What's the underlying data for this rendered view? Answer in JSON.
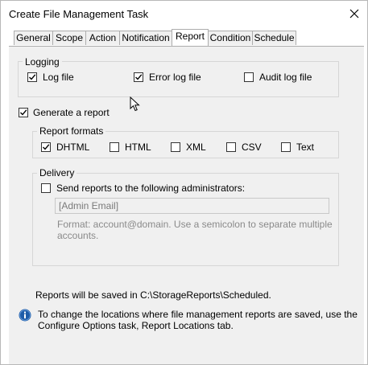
{
  "window": {
    "title": "Create File Management Task"
  },
  "tabs": [
    {
      "label": "General"
    },
    {
      "label": "Scope"
    },
    {
      "label": "Action"
    },
    {
      "label": "Notification"
    },
    {
      "label": "Report",
      "active": true
    },
    {
      "label": "Condition"
    },
    {
      "label": "Schedule"
    }
  ],
  "logging": {
    "group_label": "Logging",
    "log_file": {
      "label": "Log file",
      "checked": true
    },
    "error_log_file": {
      "label": "Error log file",
      "checked": true
    },
    "audit_log_file": {
      "label": "Audit log file",
      "checked": false
    }
  },
  "generate_report": {
    "label": "Generate a report",
    "checked": true
  },
  "report_formats": {
    "group_label": "Report formats",
    "dhtml": {
      "label": "DHTML",
      "checked": true
    },
    "html": {
      "label": "HTML",
      "checked": false
    },
    "xml": {
      "label": "XML",
      "checked": false
    },
    "csv": {
      "label": "CSV",
      "checked": false
    },
    "text": {
      "label": "Text",
      "checked": false
    }
  },
  "delivery": {
    "group_label": "Delivery",
    "send_reports": {
      "label": "Send reports to the following administrators:",
      "checked": false
    },
    "email_placeholder": "[Admin Email]",
    "format_hint_line1": "Format: account@domain. Use a semicolon to separate multiple",
    "format_hint_line2": "accounts."
  },
  "footer": {
    "saved_path_text": "Reports will be saved in C:\\StorageReports\\Scheduled.",
    "info_line1": "To change the locations where file management reports are saved, use the",
    "info_line2": "Configure Options task, Report Locations tab."
  },
  "colors": {
    "info_icon": "#1e5ca8",
    "panel_bg": "#f0f0f0",
    "disabled_text": "#8a8a8a"
  }
}
